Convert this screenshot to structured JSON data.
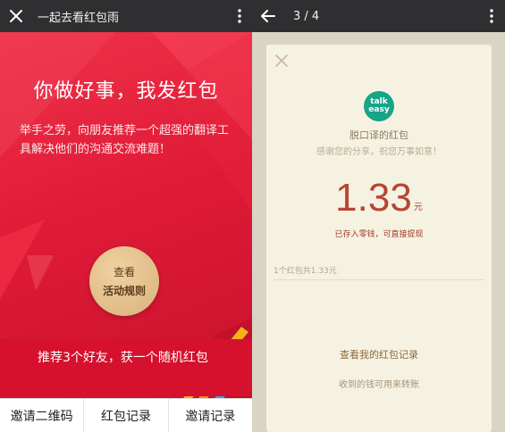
{
  "left_window": {
    "title": "一起去看红包雨",
    "headline": "你做好事，我发红包",
    "subtext": "举手之劳，向朋友推荐一个超强的翻译工具解决他们的沟通交流难题！",
    "rules_button": {
      "line1": "查看",
      "line2": "活动规则"
    },
    "banner": "推荐3个好友，获一个随机红包",
    "tabs": [
      {
        "label": "邀请二维码"
      },
      {
        "label": "红包记录"
      },
      {
        "label": "邀请记录"
      }
    ]
  },
  "right_window": {
    "pager": "3 / 4",
    "card": {
      "logo_text": [
        "talk",
        "easy"
      ],
      "sender": "脱口译的红包",
      "wish": "感谢您的分享，祝您万事如意！",
      "amount": "1.33",
      "unit": "元",
      "stored_note": "已存入零钱，可直接提现",
      "summary": "1个红包共1.33元",
      "records_link": "查看我的红包记录",
      "transfer_note": "收到的钱可用来转账"
    }
  },
  "colors": {
    "promo_red": "#e01b38",
    "topbar": "#2f2f31",
    "rules_gold": "#d8b27b",
    "card_bg": "#f6f2e2",
    "amount_red": "#b54634",
    "logo_green": "#17a487"
  }
}
